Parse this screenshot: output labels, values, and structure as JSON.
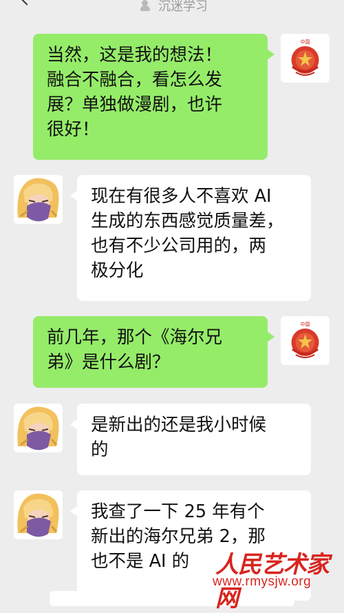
{
  "header": {
    "title": "沉迷学习"
  },
  "messages": [
    {
      "sender": "self",
      "text": "当然，这是我的想法！\n融合不融合，看怎么发\n展？单独做漫剧，也许\n很好！"
    },
    {
      "sender": "other",
      "text": "现在有很多人不喜欢 AI\n生成的东西感觉质量差，\n也有不少公司用的，两\n极分化"
    },
    {
      "sender": "self",
      "text": "前几年，那个《海尔兄\n弟》是什么剧？"
    },
    {
      "sender": "other",
      "text": "是新出的还是我小时候\n的"
    },
    {
      "sender": "other",
      "text": "我查了一下 25 年有个\n新出的海尔兄弟 2，那\n也不是 AI 的"
    }
  ],
  "watermark": {
    "title": "人民艺术家网",
    "url": "www.rmysjw.org"
  },
  "colors": {
    "background": "#ededed",
    "self_bubble": "#95ec69",
    "other_bubble": "#ffffff",
    "watermark": "#d8251f"
  },
  "avatars": {
    "self": "emblem-icon",
    "other": "cartoon-character-icon"
  }
}
